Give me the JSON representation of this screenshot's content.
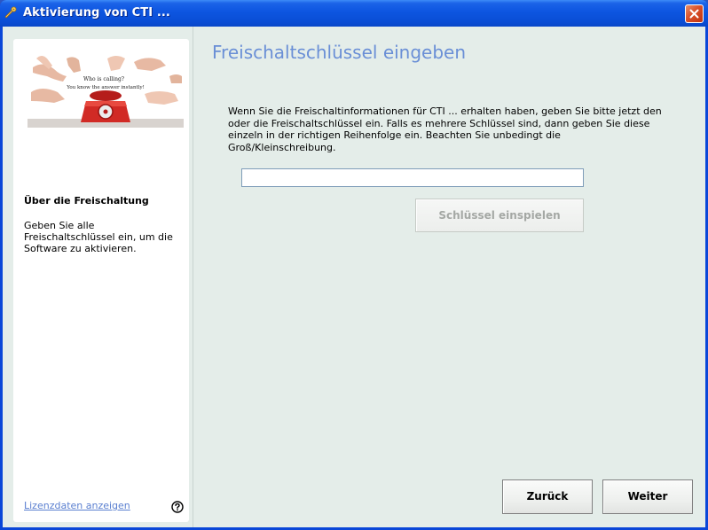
{
  "window": {
    "title": "Aktivierung von CTI ...",
    "icon": "key-wand-icon"
  },
  "sidebar": {
    "hero": {
      "caption_line1": "Who is calling?",
      "caption_line2": "You know the answer instantly!"
    },
    "heading": "Über die Freischaltung",
    "description": "Geben Sie alle Freischaltschlüssel ein, um die Software zu aktivieren.",
    "license_link": "Lizenzdaten anzeigen",
    "help_icon": "question-circle-icon"
  },
  "main": {
    "title": "Freischaltschlüssel eingeben",
    "intro": "Wenn Sie die Freischaltinformationen für CTI ... erhalten haben, geben Sie bitte jetzt den oder die Freischaltschlüssel ein. Falls es mehrere Schlüssel sind, dann geben Sie diese einzeln in der richtigen Reihenfolge ein. Beachten Sie unbedingt die Groß/Kleinschreibung.",
    "key_input": {
      "value": "",
      "placeholder": ""
    },
    "apply_button": "Schlüssel einspielen"
  },
  "footer": {
    "back_button": "Zurück",
    "next_button": "Weiter"
  },
  "colors": {
    "titlebar": "#0a4ed6",
    "client_bg": "#e4ede9",
    "title_accent": "#6a8fd6",
    "link": "#5a7fd0",
    "close_button": "#d9502a"
  }
}
